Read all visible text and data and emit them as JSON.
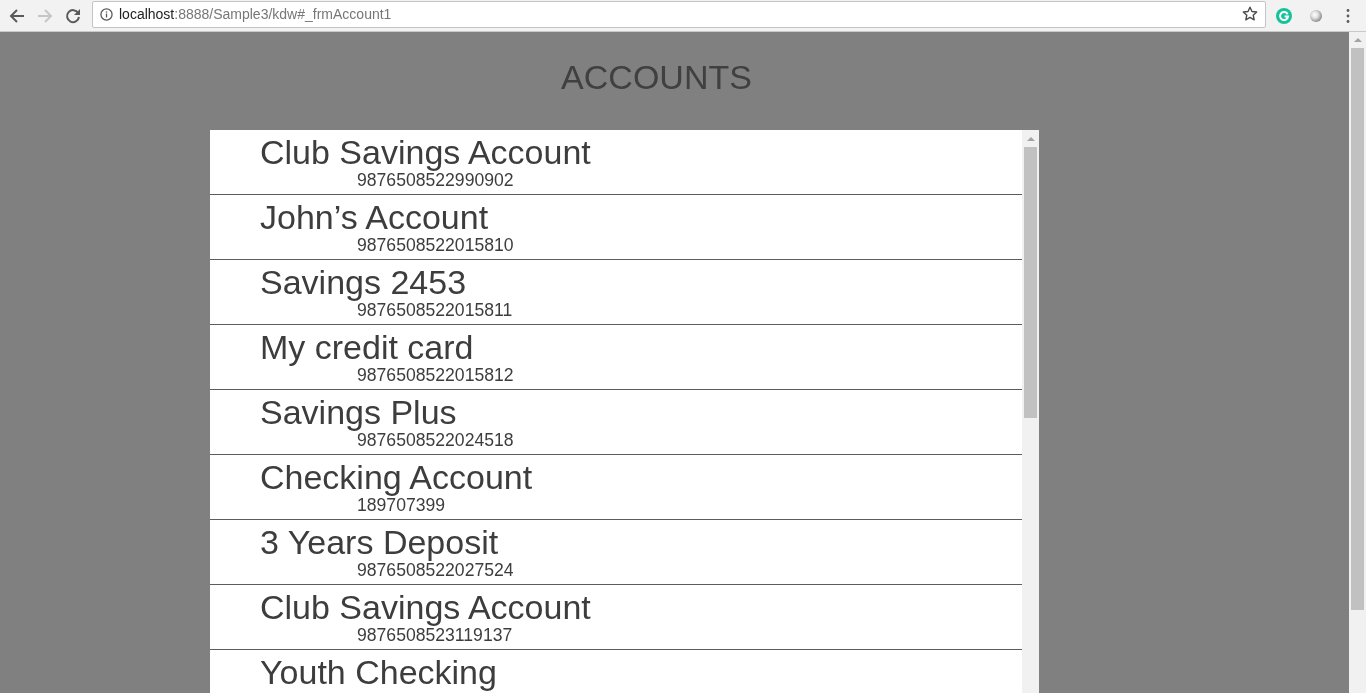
{
  "browser": {
    "nav_buttons": [
      {
        "kind": "back",
        "disabled": false
      },
      {
        "kind": "forward",
        "disabled": true
      },
      {
        "kind": "reload",
        "disabled": false
      }
    ],
    "url_host": "localhost",
    "url_rest": ":8888/Sample3/kdw#_frmAccount1"
  },
  "page": {
    "title": "ACCOUNTS",
    "accounts": [
      {
        "name": "Club Savings Account",
        "number": "9876508522990902"
      },
      {
        "name": "John’s Account",
        "number": "9876508522015810"
      },
      {
        "name": "Savings 2453",
        "number": "9876508522015811"
      },
      {
        "name": "My credit card",
        "number": "9876508522015812"
      },
      {
        "name": "Savings Plus",
        "number": "9876508522024518"
      },
      {
        "name": "Checking Account",
        "number": "189707399"
      },
      {
        "name": "3 Years Deposit",
        "number": "9876508522027524"
      },
      {
        "name": "Club Savings Account",
        "number": "9876508523119137"
      },
      {
        "name": "Youth Checking"
      }
    ]
  }
}
